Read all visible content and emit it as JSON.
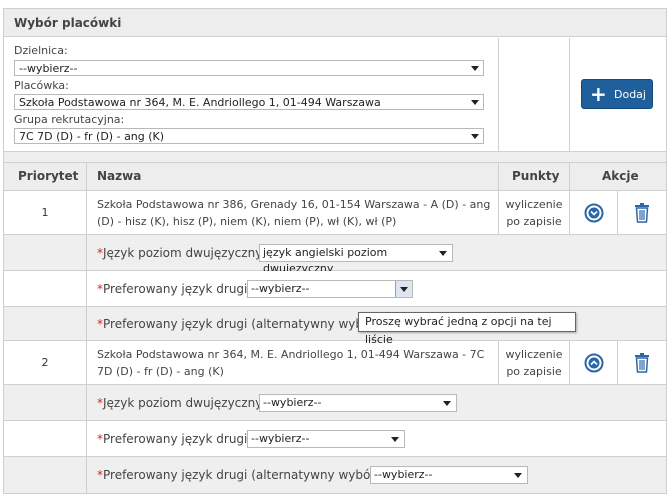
{
  "panel": {
    "title": "Wybór placówki"
  },
  "selection": {
    "district_label": "Dzielnica:",
    "district_value": "--wybierz--",
    "school_label": "Placówka:",
    "school_value": "Szkoła Podstawowa nr 364, M. E. Andriollego 1, 01-494 Warszawa",
    "group_label": "Grupa rekrutacyjna:",
    "group_value": "7C 7D (D) - fr (D) - ang (K)",
    "add_button": "Dodaj"
  },
  "table": {
    "headers": {
      "priority": "Priorytet",
      "name": "Nazwa",
      "points": "Punkty",
      "actions": "Akcje"
    },
    "rows": [
      {
        "priority": "1",
        "name": "Szkoła Podstawowa nr 386, Grenady 16, 01-154 Warszawa - A (D) - ang (D) - hisz (K), hisz (P), niem (K), niem (P), wł (K), wł (P)",
        "points_line1": "wyliczenie",
        "points_line2": "po zapisie",
        "subrows": {
          "bilingual_label": "Język poziom dwujęzyczny",
          "bilingual_value": "język angielski poziom dwujęzyczny",
          "second_lang_label": "Preferowany język drugi",
          "second_lang_value": "--wybierz--",
          "alt_lang_label": "Preferowany język drugi (alternatywny wybór)"
        }
      },
      {
        "priority": "2",
        "name": "Szkoła Podstawowa nr 364, M. E. Andriollego 1, 01-494 Warszawa - 7C 7D (D) - fr (D) - ang (K)",
        "points_line1": "wyliczenie",
        "points_line2": "po zapisie",
        "subrows": {
          "bilingual_label": "Język poziom dwujęzyczny",
          "bilingual_value": "--wybierz--",
          "second_lang_label": "Preferowany język drugi",
          "second_lang_value": "--wybierz--",
          "alt_lang_label": "Preferowany język drugi (alternatywny wybór)",
          "alt_lang_value": "--wybierz--"
        }
      }
    ]
  },
  "tooltip": "Proszę wybrać jedną z opcji na tej liście",
  "required_marker": "*",
  "colors": {
    "accent": "#1e5f9c",
    "required": "#dd2222",
    "icon": "#2a66a8"
  }
}
